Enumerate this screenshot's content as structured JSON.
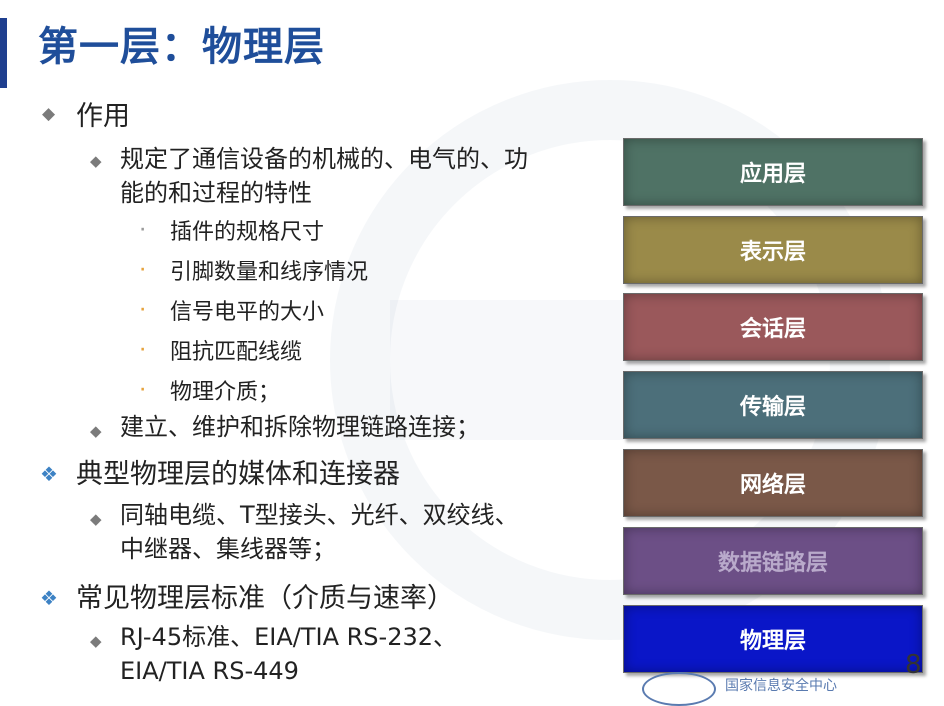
{
  "slide": {
    "title": "第一层：物理层",
    "bullets": {
      "role": "作用",
      "role_desc_line1": "规定了通信设备的机械的、电气的、功",
      "role_desc_line2": "能的和过程的特性",
      "sub_items": [
        "插件的规格尺寸",
        "引脚数量和线序情况",
        "信号电平的大小",
        "阻抗匹配线缆",
        "物理介质；"
      ],
      "link_item": "建立、维护和拆除物理链路连接；",
      "media_title": "典型物理层的媒体和连接器",
      "media_line1": "同轴电缆、T型接头、光纤、双绞线、",
      "media_line2": "中继器、集线器等；",
      "standards_title": "常见物理层标准（介质与速率）",
      "standards_line1": "RJ-45标准、EIA/TIA RS-232、",
      "standards_line2": "EIA/TIA RS-449"
    },
    "osi_layers": [
      {
        "label": "应用层",
        "color": "#4f7265",
        "text_color": "#ffffff"
      },
      {
        "label": "表示层",
        "color": "#9a8a49",
        "text_color": "#ffffff"
      },
      {
        "label": "会话层",
        "color": "#9a585b",
        "text_color": "#ffffff"
      },
      {
        "label": "传输层",
        "color": "#4c6f7a",
        "text_color": "#ffffff"
      },
      {
        "label": "网络层",
        "color": "#7a5848",
        "text_color": "#ffffff"
      },
      {
        "label": "数据链路层",
        "color": "#6c4f86",
        "text_color": "#b9aacb"
      },
      {
        "label": "物理层",
        "color": "#0a16c8",
        "text_color": "#ffffff"
      }
    ],
    "page_number": "8",
    "footer_text": "国家信息安全中心"
  }
}
